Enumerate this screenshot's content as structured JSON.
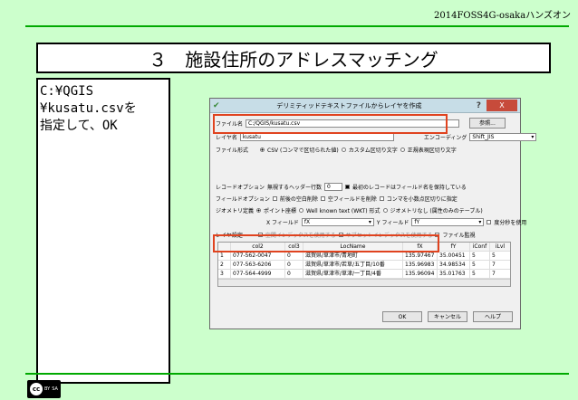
{
  "header": {
    "text": "2014FOSS4G-osakaハンズオン"
  },
  "title": "３　施設住所のアドレスマッチング",
  "instructions": [
    "C:¥QGIS",
    "¥kusatu.csvを",
    "指定して、OK"
  ],
  "dialog": {
    "title": "デリミティッドテキストファイルからレイヤを作成",
    "help": "?",
    "close": "X",
    "file_label": "ファイル名",
    "file_value": "C:/QGIS/kusatu.csv",
    "browse": "参照...",
    "layer_label": "レイヤ名",
    "layer_value": "kusatu",
    "encoding_label": "エンコーディング",
    "encoding_value": "Shift_JIS",
    "format_label": "ファイル形式",
    "format_csv": "CSV (コンマで区切られた値)",
    "format_custom": "カスタム区切り文字",
    "format_regex": "正規表現区切り文字",
    "record_label": "レコードオプション",
    "skip_label": "無視するヘッダー行数",
    "skip_value": "0",
    "first_record": "最初のレコードはフィールド名を保持している",
    "field_label": "フィールドオプション",
    "trim": "前後の空白削除",
    "empty": "空フィールドを削除",
    "comma": "コンマを小数点区切りに指定",
    "geom_label": "ジオメトリ定義",
    "point": "ポイント座標",
    "wkt": "Well known text (WKT) 形式",
    "nogeom": "ジオメトリなし (属性のみのテーブル)",
    "xfield_label": "X フィールド",
    "xfield_value": "fX",
    "yfield_label": "Y フィールド",
    "yfield_value": "fY",
    "dms": "度分秒を使用",
    "layer_settings": "レイヤ設定",
    "spatial_index": "空間インデックスを使用する",
    "subset_index": "サブセットインデックスを使用する",
    "watch": "ファイル監視",
    "columns": [
      "",
      "col2",
      "col3",
      "LocName",
      "fX",
      "fY",
      "iConf",
      "iLvl"
    ],
    "rows": [
      [
        "1",
        "077-562-0047",
        "0",
        "滋賀県/草津市/青地町",
        "135.97467",
        "35.00451",
        "5",
        "5"
      ],
      [
        "2",
        "077-563-6206",
        "0",
        "滋賀県/草津市/若草/五丁目/10番",
        "135.96983",
        "34.98534",
        "5",
        "7"
      ],
      [
        "3",
        "077-564-4999",
        "0",
        "滋賀県/草津市/草津/一丁目/4番",
        "135.96094",
        "35.01763",
        "5",
        "7"
      ]
    ],
    "ok": "OK",
    "cancel": "キャンセル",
    "helpbtn": "ヘルプ"
  },
  "license": {
    "cc": "cc",
    "by": "BY",
    "sa": "SA"
  }
}
